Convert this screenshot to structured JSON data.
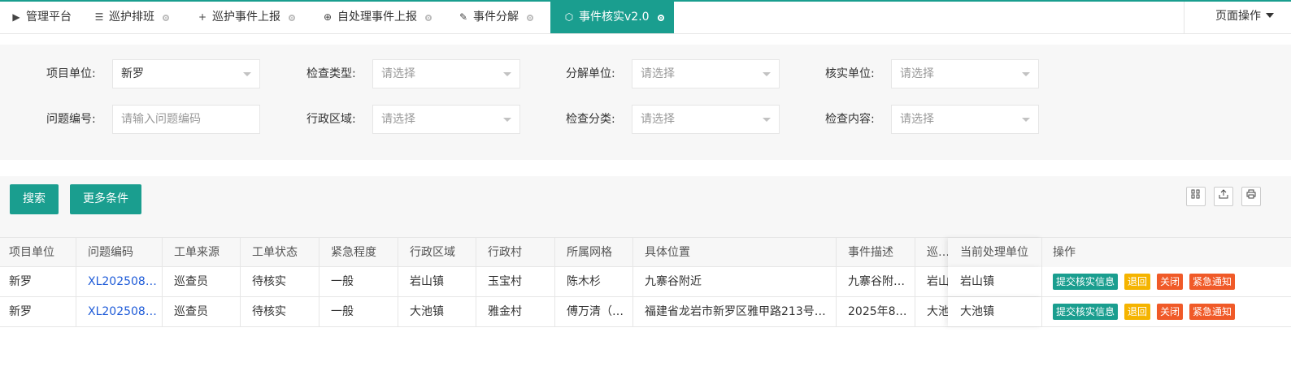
{
  "tabs": [
    {
      "label": "管理平台",
      "icon": "play-icon",
      "glyph": "▶"
    },
    {
      "label": "巡护排班",
      "icon": "list-icon",
      "glyph": "☰"
    },
    {
      "label": "巡护事件上报",
      "icon": "plus-icon",
      "glyph": "+"
    },
    {
      "label": "自处理事件上报",
      "icon": "circle-plus-icon",
      "glyph": "⊕"
    },
    {
      "label": "事件分解",
      "icon": "edit-doc-icon",
      "glyph": "✎"
    },
    {
      "label": "事件核实v2.0",
      "icon": "cube-icon",
      "glyph": "⬡"
    }
  ],
  "page_ops": "页面操作",
  "filters": {
    "project_unit": {
      "label": "项目单位:",
      "value": "新罗"
    },
    "check_type": {
      "label": "检查类型:",
      "placeholder": "请选择"
    },
    "decompose_unit": {
      "label": "分解单位:",
      "placeholder": "请选择"
    },
    "verify_unit": {
      "label": "核实单位:",
      "placeholder": "请选择"
    },
    "issue_no": {
      "label": "问题编号:",
      "placeholder": "请输入问题编码"
    },
    "admin_area": {
      "label": "行政区域:",
      "placeholder": "请选择"
    },
    "check_category": {
      "label": "检查分类:",
      "placeholder": "请选择"
    },
    "check_content": {
      "label": "检查内容:",
      "placeholder": "请选择"
    }
  },
  "actions": {
    "search": "搜索",
    "more": "更多条件"
  },
  "toolbar": {
    "columns_icon": "columns-icon",
    "export_icon": "export-icon",
    "print_icon": "print-icon"
  },
  "table": {
    "headers": [
      "项目单位",
      "问题编码",
      "工单来源",
      "工单状态",
      "紧急程度",
      "行政区域",
      "行政村",
      "所属网格",
      "具体位置",
      "事件描述",
      "巡护",
      "当前处理单位",
      "操作"
    ],
    "rows": [
      [
        "新罗",
        "XL202508…",
        "巡查员",
        "待核实",
        "一般",
        "岩山镇",
        "玉宝村",
        "陈木杉",
        "九寨谷附近",
        "九寨谷附…",
        "岩山",
        "岩山镇"
      ],
      [
        "新罗",
        "XL202508…",
        "巡查员",
        "待核实",
        "一般",
        "大池镇",
        "雅金村",
        "傅万清（…",
        "福建省龙岩市新罗区雅甲路213号…",
        "2025年8…",
        "大池",
        "大池镇"
      ]
    ],
    "ops": [
      {
        "label": "提交核实信息",
        "color": "#1a9e8f"
      },
      {
        "label": "退回",
        "color": "#f5b400"
      },
      {
        "label": "关闭",
        "color": "#f05a28"
      },
      {
        "label": "紧急通知",
        "color": "#f05a28"
      }
    ]
  },
  "colors": {
    "accent": "#1a9e8f",
    "link": "#1e5bd8"
  }
}
